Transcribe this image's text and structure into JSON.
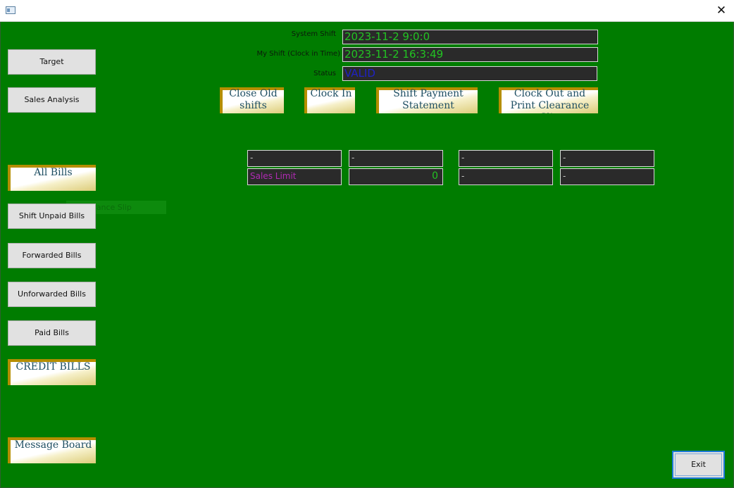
{
  "window": {
    "close_glyph": "✕"
  },
  "header": {
    "system_shift": {
      "label": "System Shift",
      "value": "2023-11-2 9:0:0"
    },
    "my_shift": {
      "label": "My Shift (Clock in Time)",
      "value": "2023-11-2 16:3:49"
    },
    "status": {
      "label": "Status",
      "value": "VALID"
    }
  },
  "actions": {
    "close_old_shifts": "Close Old shifts",
    "clock_in": "Clock In",
    "shift_payment_statement": "Shift Payment Statement",
    "clock_out_print": "Clock Out and Print Clearance Slip"
  },
  "grid": {
    "r1c1": "-",
    "r1c2": "-",
    "r1c3": "-",
    "r1c4": "-",
    "r2c1": "Sales Limit",
    "r2c2": "0",
    "r2c3": "-",
    "r2c4": "-"
  },
  "sidebar": {
    "target": "Target",
    "sales_analysis": "Sales Analysis",
    "all_bills": "All Bills",
    "ghost_text": "Clearance Slip",
    "shift_unpaid_bills": "Shift Unpaid Bills",
    "forwarded_bills": "Forwarded Bills",
    "unforwarded_bills": "Unforwarded Bills",
    "paid_bills": "Paid Bills",
    "credit_bills": "CREDIT BILLS",
    "message_board": "Message Board"
  },
  "footer": {
    "exit": "Exit"
  },
  "colors": {
    "background": "#007c00",
    "field_bg": "#2a2a2a",
    "field_text_green": "#22c322",
    "status_text_blue": "#1f22c4",
    "sales_limit_magenta": "#b12bb4",
    "gold_accent": "#b58e00",
    "gold_button_text": "#1e4e62"
  },
  "icons": {
    "app": "app-window-icon",
    "close": "close-icon"
  }
}
